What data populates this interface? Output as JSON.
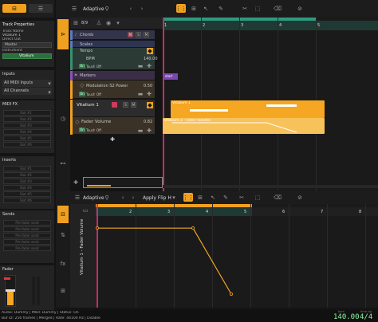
{
  "colors": {
    "accent": "#f0a020",
    "bg": "#141414",
    "panel": "#232323",
    "clip": "#f5a623",
    "clip_light": "#f8c25a",
    "playhead": "#c0306a",
    "green_ruler": "#2e7d63",
    "automation": "#f5a623"
  },
  "top_bar": {
    "preset": "Adaptive",
    "count": "8/9"
  },
  "inspector": {
    "title": "Track Properties",
    "track_name_label": "Track Name",
    "track_name": "Vitalium 1",
    "direct_out_label": "Direct Out",
    "direct_out_value": "Master",
    "instrument_label": "Instrument",
    "instrument_value": "Vitalium",
    "inputs_title": "Inputs",
    "inputs_value": "All MIDI Inputs",
    "channels_value": "All Channels",
    "midi_fx_title": "MIDI FX",
    "midi_fx_slots": [
      "Slot #1",
      "Slot #2",
      "Slot #3",
      "Slot #4",
      "Slot #5",
      "Slot #6"
    ],
    "inserts_title": "Inserts",
    "insert_slots": [
      "Slot #1",
      "Slot #2",
      "Slot #3",
      "Slot #4",
      "Slot #5",
      "Slot #6"
    ],
    "sends_title": "Sends",
    "send_slots": [
      "Pre-fader send",
      "Pre-fader send",
      "Pre-fader send",
      "Pre-fader send",
      "Pre-fader send"
    ],
    "fader_title": "Fader"
  },
  "tracks": {
    "chords": "Chords",
    "scales": "Scales",
    "tempo": "Tempo",
    "bpm_label": "BPM",
    "bpm_value": "140.00",
    "touch_label": "Touch",
    "off_label": "Off",
    "on_label": "On",
    "markers": "Markers",
    "modulation": "Modulation S2 Power",
    "modulation_value": "0.50",
    "vitalium": "Vitalium 1",
    "fader_volume": "Fader Volume",
    "fader_volume_value": "0.82"
  },
  "arrange": {
    "ruler": [
      "1",
      "2",
      "3",
      "4",
      "5"
    ],
    "marker_start": "start",
    "clip1_label": "Vitalium 1",
    "clip2_label": "Vitalium 1 - Fader Volume"
  },
  "editor": {
    "preset": "Adaptive",
    "apply_label": "Apply Flip H",
    "ruler": [
      "2",
      "3",
      "4",
      "5",
      "6",
      "7",
      "8"
    ],
    "vertical_label": "Vitalium 1 - Fader Volume",
    "automation_points": [
      {
        "beat": 1.0,
        "value": 0.82
      },
      {
        "beat": 3.5,
        "value": 0.82
      },
      {
        "beat": 4.5,
        "value": 0.0
      }
    ]
  },
  "status": {
    "line1": "Audio: Dummy | MIDI: Dummy | Status: On",
    "line2": "Buf sz: 256 frames | Merged | Rate: 44100 Hz | Disable",
    "bpm_label": "bpm",
    "time_label": "time sig",
    "bpm_value": "140.00",
    "time_value": "4/4"
  }
}
